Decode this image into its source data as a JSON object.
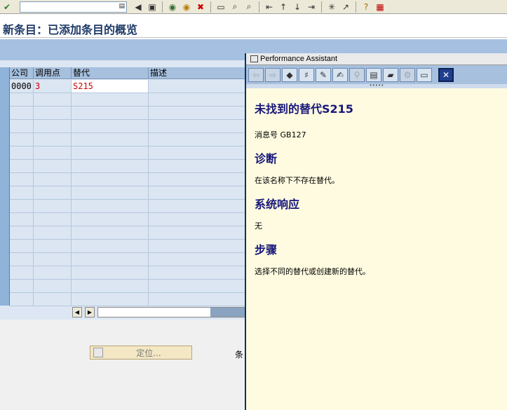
{
  "toolbar": {
    "command_field": "",
    "icons": [
      "check-icon",
      "command-dropdown",
      "back-icon",
      "save-icon",
      "nav-back-icon",
      "exit-icon",
      "cancel-icon",
      "print-icon",
      "find-icon",
      "find-next-icon",
      "first-page-icon",
      "prev-page-icon",
      "next-page-icon",
      "last-page-icon",
      "new-session-icon",
      "shortcut-icon",
      "help-icon",
      "layout-icon"
    ]
  },
  "page_title": "新条目：已添加条目的概览",
  "table": {
    "columns": [
      "公司",
      "调用点",
      "替代",
      "描述"
    ],
    "rows": [
      {
        "company": "0000",
        "callpoint": "3",
        "substitution": "S215",
        "description": ""
      }
    ]
  },
  "position_button": "定位...",
  "entry_label": "条",
  "assistant": {
    "window_title": "Performance Assistant",
    "heading": "未找到的替代S215",
    "message_number": "消息号  GB127",
    "sections": [
      {
        "title": "诊断",
        "text": "在该名称下不存在替代。"
      },
      {
        "title": "系统响应",
        "text": "无"
      },
      {
        "title": "步骤",
        "text": "选择不同的替代或创建新的替代。"
      }
    ]
  },
  "colors": {
    "heading": "#17177a",
    "assistant_bg": "#fffbe0",
    "table_bg": "#dbe6f2",
    "red_value": "#cc0000"
  }
}
